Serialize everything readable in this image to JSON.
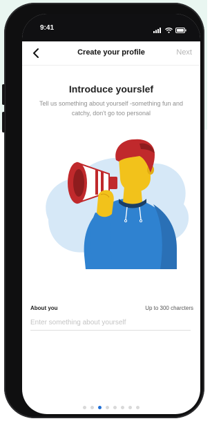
{
  "status_bar": {
    "time": "9:41",
    "signal_icon": "signal-icon",
    "wifi_icon": "wifi-icon",
    "battery_icon": "battery-icon"
  },
  "nav": {
    "back_icon": "chevron-left-icon",
    "title": "Create your profile",
    "next_label": "Next"
  },
  "intro": {
    "headline": "Introduce yourslef",
    "subtext": "Tell us something about yourself -something fun and catchy, don't go too personal"
  },
  "illustration": {
    "name": "person-with-megaphone-illustration"
  },
  "about_field": {
    "label": "About you",
    "limit": "Up to 300 charcters",
    "value": "",
    "placeholder": "Enter something about yourself"
  },
  "pager": {
    "total": 8,
    "active_index": 2
  },
  "colors": {
    "accent": "#1f6fd6",
    "background_tint": "#e9f6f1",
    "phone_frame": "#0f0f10",
    "hoodie": "#2f82d0",
    "hair": "#c0292c",
    "skin": "#f2c21b",
    "blob": "#d6e8f7"
  }
}
